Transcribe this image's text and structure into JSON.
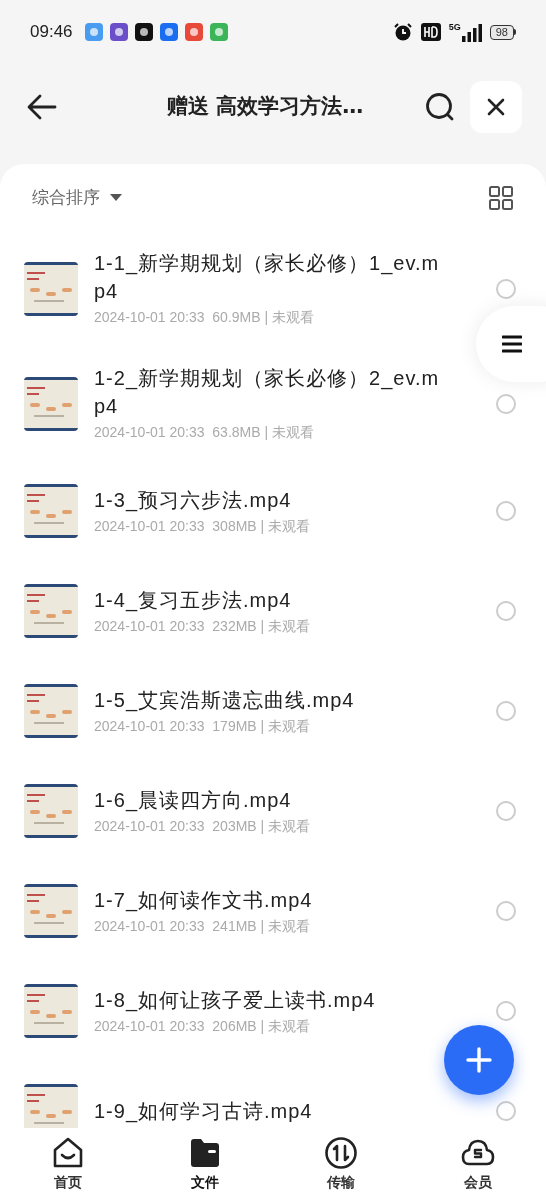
{
  "status_bar": {
    "time": "09:46",
    "network": "5G",
    "battery": "98"
  },
  "header": {
    "title": "赠送 高效学习方法…"
  },
  "toolbar": {
    "sort_label": "综合排序"
  },
  "files": [
    {
      "title": "1-1_新学期规划（家长必修）1_ev.mp4",
      "meta": "2024-10-01 20:33  60.9MB | 未观看",
      "selected": false
    },
    {
      "title": "1-2_新学期规划（家长必修）2_ev.mp4",
      "meta": "2024-10-01 20:33  63.8MB | 未观看",
      "selected": false
    },
    {
      "title": "1-3_预习六步法.mp4",
      "meta": "2024-10-01 20:33  308MB | 未观看",
      "selected": false
    },
    {
      "title": "1-4_复习五步法.mp4",
      "meta": "2024-10-01 20:33  232MB | 未观看",
      "selected": false
    },
    {
      "title": "1-5_艾宾浩斯遗忘曲线.mp4",
      "meta": "2024-10-01 20:33  179MB | 未观看",
      "selected": false
    },
    {
      "title": "1-6_晨读四方向.mp4",
      "meta": "2024-10-01 20:33  203MB | 未观看",
      "selected": false
    },
    {
      "title": "1-7_如何读作文书.mp4",
      "meta": "2024-10-01 20:33  241MB | 未观看",
      "selected": false
    },
    {
      "title": "1-8_如何让孩子爱上读书.mp4",
      "meta": "2024-10-01 20:33  206MB | 未观看",
      "selected": false
    },
    {
      "title": "1-9_如何学习古诗.mp4",
      "selected": false
    }
  ],
  "bottom_nav": [
    {
      "label": "首页",
      "kind": "home",
      "selected": false
    },
    {
      "label": "文件",
      "kind": "files",
      "selected": true
    },
    {
      "label": "传输",
      "kind": "transfer",
      "selected": false
    },
    {
      "label": "会员",
      "kind": "vip",
      "selected": false
    }
  ]
}
